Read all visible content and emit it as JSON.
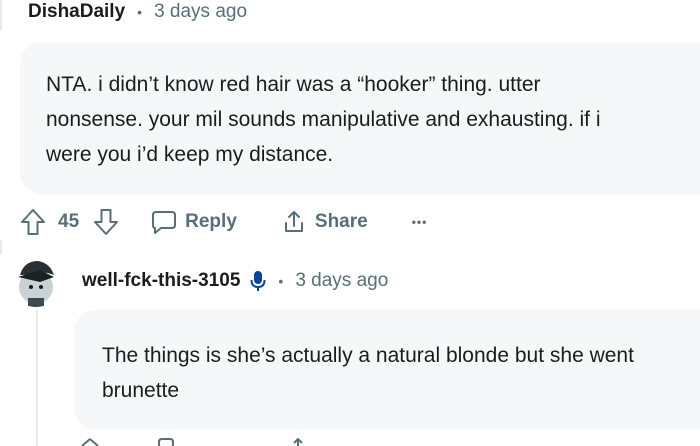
{
  "comment1": {
    "author": "DishaDaily",
    "time": "3 days ago",
    "body_line1": "NTA. i didn’t know red hair was a “hooker” thing. utter",
    "body_line2": "nonsense. your mil sounds manipulative and exhausting. if i",
    "body_line3": "were you i’d keep my distance.",
    "votes": "45",
    "reply_label": "Reply",
    "share_label": "Share",
    "more_label": "•••"
  },
  "comment2": {
    "author": "well-fck-this-3105",
    "time": "3 days ago",
    "body_line1": "The things is she’s actually a natural blonde but she went",
    "body_line2": "brunette"
  },
  "colors": {
    "bubble": "#f6f7f8",
    "meta_gray": "#576f76",
    "text": "#1c1c1c",
    "mic_blue": "#0a449b"
  },
  "icons": [
    "upvote-icon",
    "downvote-icon",
    "comment-bubble-icon",
    "share-icon",
    "more-icon",
    "microphone-icon"
  ]
}
